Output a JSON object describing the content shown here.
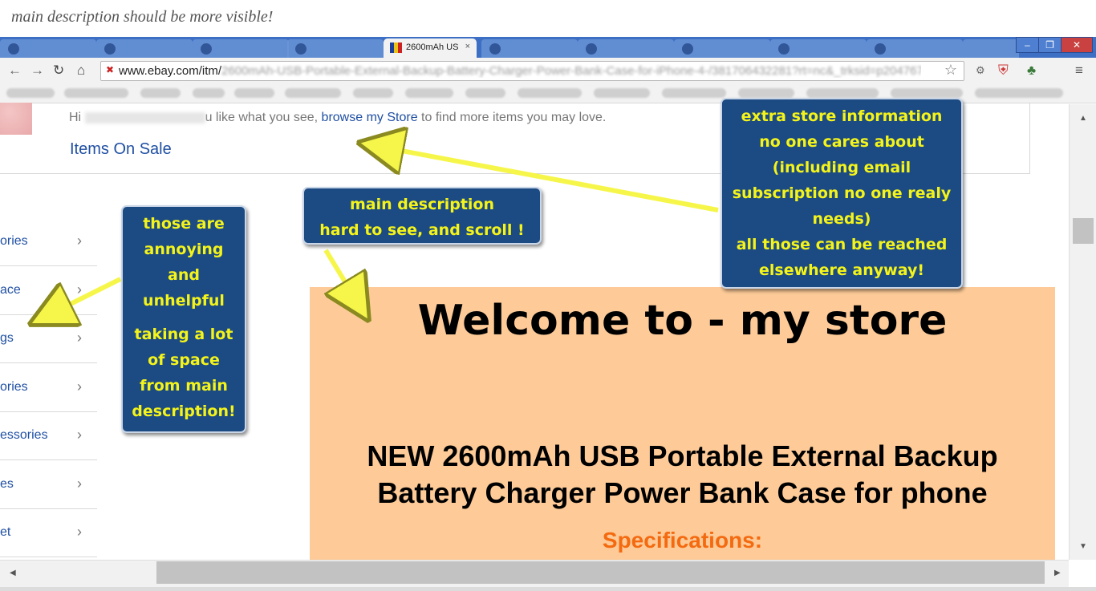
{
  "caption": "main description should be more visible!",
  "browser": {
    "active_tab_title": "2600mAh US",
    "active_tab_close": "×",
    "url_domain": "www.ebay.com/itm/",
    "url_rest": "2600mAh-USB-Portable-External-Backup-Battery-Charger-Power-Bank-Case-for-iPhone-4-/381706432281?rt=nc&_trksid=p2047675",
    "window_buttons": [
      "–",
      "❐",
      "✕"
    ]
  },
  "store": {
    "greeting_prefix": "Hi",
    "greeting_mid": "u like what you see,",
    "browse_link": "browse my Store",
    "greeting_suffix": "to find more items you may love.",
    "items_on_sale": "Items On Sale"
  },
  "categories": [
    {
      "label": "ories"
    },
    {
      "label": "ace"
    },
    {
      "label": "gs"
    },
    {
      "label": "ories"
    },
    {
      "label": "essories"
    },
    {
      "label": "es"
    },
    {
      "label": "et"
    }
  ],
  "chevron": "›",
  "description": {
    "welcome": "Welcome to - my store",
    "product_line1": "NEW 2600mAh USB Portable External Backup",
    "product_line2": "Battery Charger Power Bank Case for phone",
    "specifications": "Specifications:"
  },
  "annotations": {
    "left_line1": "those are",
    "left_line2": "annoying",
    "left_line3": "and",
    "left_line4": "unhelpful",
    "left_line5": "taking a lot",
    "left_line6": "of space",
    "left_line7": "from main",
    "left_line8": "description!",
    "mid_line1": "main description",
    "mid_line2": "hard to see, and scroll !",
    "right_line1": "extra store information",
    "right_line2": "no one cares about",
    "right_line3": "(including email",
    "right_line4": "subscription no one realy",
    "right_line5": "needs)",
    "right_line6": "all those can be reached",
    "right_line7": "elsewhere anyway!"
  },
  "colors": {
    "annotation_bg": "#1c4a82",
    "annotation_text": "#f4f41a",
    "arrow": "#f6f64a",
    "description_bg": "#fecb98",
    "spec_color": "#f46a10",
    "link": "#1f4fa3"
  }
}
